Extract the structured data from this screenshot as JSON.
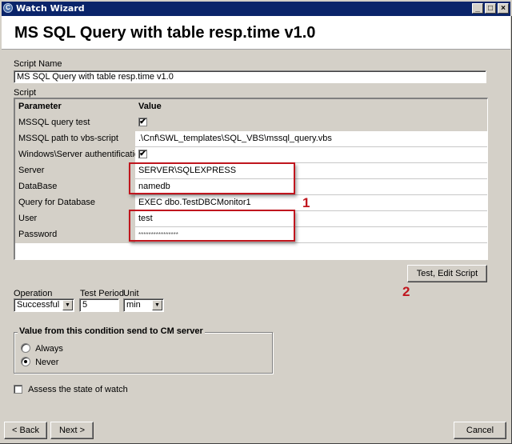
{
  "window": {
    "title": "Watch Wizard",
    "app_icon": "C",
    "controls": {
      "minimize": "_",
      "maximize": "□",
      "close": "×"
    }
  },
  "header": {
    "title": "MS SQL Query with table resp.time v1.0"
  },
  "script_name": {
    "label": "Script Name",
    "value": "MS SQL Query with table resp.time v1.0"
  },
  "script": {
    "label": "Script",
    "columns": {
      "parameter": "Parameter",
      "value": "Value"
    },
    "rows": [
      {
        "param": "MSSQL query test",
        "type": "checkbox",
        "value": "✔",
        "checked": true
      },
      {
        "param": "MSSQL path to vbs-script",
        "type": "text",
        "value": ".\\Cnf\\SWL_templates\\SQL_VBS\\mssql_query.vbs"
      },
      {
        "param": "Windows\\Server authentification",
        "type": "checkbox",
        "value": "✔",
        "checked": true
      },
      {
        "param": "Server",
        "type": "text",
        "value": "SERVER\\SQLEXPRESS"
      },
      {
        "param": "DataBase",
        "type": "text",
        "value": "namedb"
      },
      {
        "param": "Query for Database",
        "type": "text",
        "value": "EXEC dbo.TestDBCMonitor1"
      },
      {
        "param": "User",
        "type": "text",
        "value": "test"
      },
      {
        "param": "Password",
        "type": "password",
        "value": "****************"
      }
    ]
  },
  "annotations": {
    "marker_1": "1",
    "marker_2": "2",
    "color": "#c0161e"
  },
  "test_edit_button": "Test, Edit Script",
  "operation": {
    "label": "Operation",
    "value": "Successful"
  },
  "test_period": {
    "label": "Test Period",
    "value": "5"
  },
  "unit": {
    "label": "Unit",
    "value": "min"
  },
  "send_group": {
    "legend": "Value from this condition send to CM server",
    "options": [
      {
        "label": "Always",
        "selected": false
      },
      {
        "label": "Never",
        "selected": true
      }
    ]
  },
  "assess": {
    "label": "Assess the state of watch",
    "checked": false
  },
  "footer": {
    "back": "< Back",
    "next": "Next >",
    "cancel": "Cancel"
  },
  "colors": {
    "titlebar": "#0a246a",
    "face": "#d4d0c8",
    "annotation": "#c0161e"
  }
}
